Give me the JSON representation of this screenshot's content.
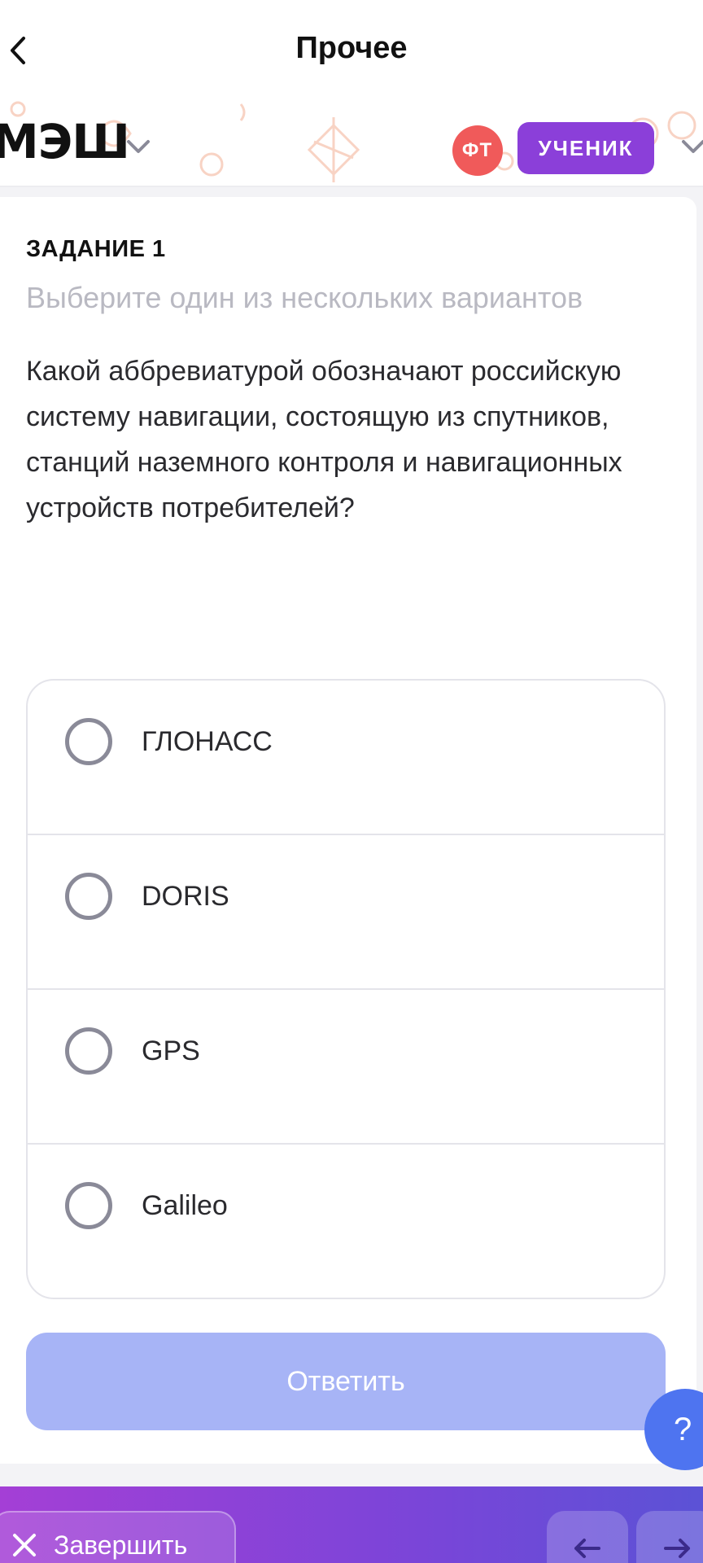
{
  "topbar": {
    "title": "Прочее"
  },
  "header": {
    "logo": "МЭШ",
    "avatar_initials": "ФТ",
    "role": "УЧЕНИК"
  },
  "task": {
    "label": "ЗАДАНИЕ 1",
    "hint": "Выберите один из нескольких вариантов",
    "question": "Какой аббревиатурой обозначают российскую систему навигации, состоящую из спутников, станций наземного контроля и навигационных устройств потребителей?"
  },
  "options": [
    {
      "label": "ГЛОНАСС",
      "selected": false
    },
    {
      "label": "DORIS",
      "selected": false
    },
    {
      "label": "GPS",
      "selected": false
    },
    {
      "label": "Galileo",
      "selected": false
    }
  ],
  "submit_label": "Ответить",
  "help_label": "?",
  "bottom": {
    "finish_label": "Завершить"
  },
  "colors": {
    "accent": "#8b3fd9",
    "avatar": "#f05a5a",
    "submit_disabled": "#a7b4f6",
    "help": "#4e74f0"
  }
}
